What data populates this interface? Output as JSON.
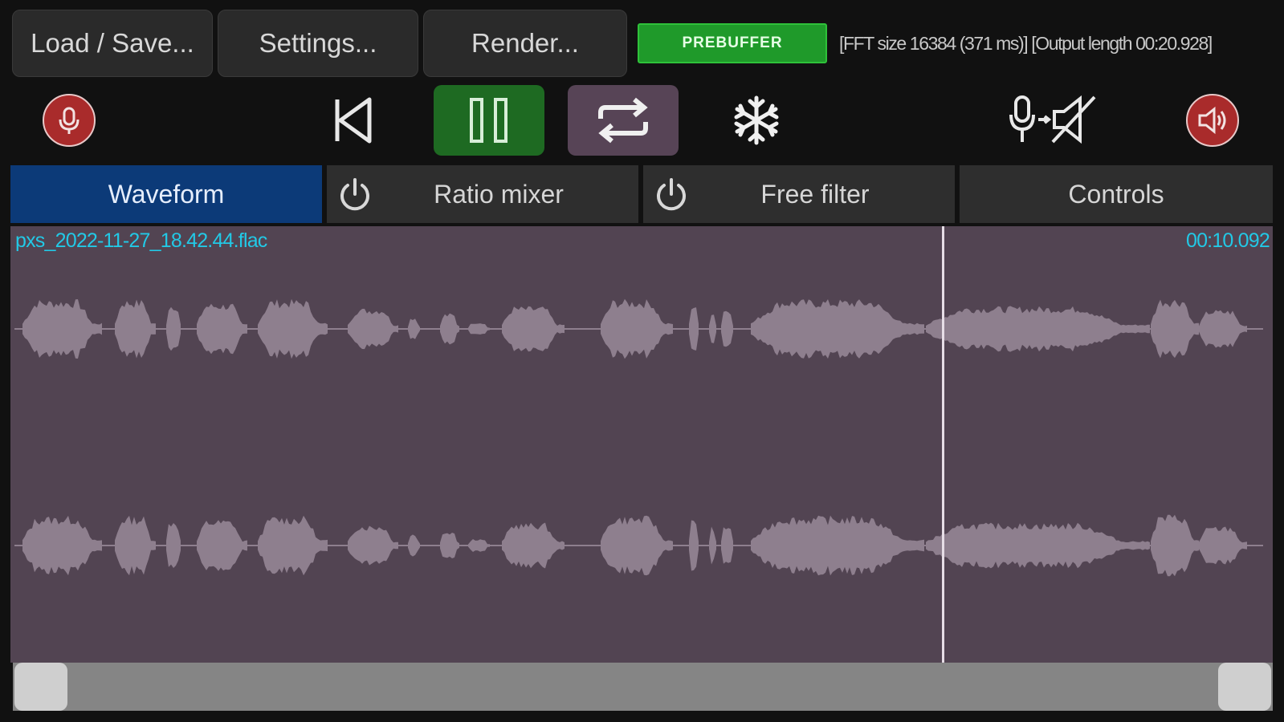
{
  "menu": {
    "load_save": "Load / Save...",
    "settings": "Settings...",
    "render": "Render..."
  },
  "status": {
    "prebuffer": "PREBUFFER",
    "info": "[FFT size 16384 (371 ms)] [Output length 00:20.928]"
  },
  "transport": {
    "icons": [
      "mic-icon",
      "rewind-icon",
      "pause-icon",
      "loop-icon",
      "snowflake-icon",
      "mic-to-mute-icon",
      "speaker-icon"
    ]
  },
  "tabs": [
    {
      "label": "Waveform",
      "active": true
    },
    {
      "label": "Ratio mixer",
      "active": false
    },
    {
      "label": "Free filter",
      "active": false
    },
    {
      "label": "Controls",
      "active": false
    }
  ],
  "waveform": {
    "filename": "pxs_2022-11-27_18.42.44.flac",
    "time": "00:10.092",
    "playhead_fraction": 0.738
  },
  "colors": {
    "accent_tab": "#0c3a78",
    "waveform_bg": "#524452",
    "waveform_fill": "#8e7f8e",
    "text_highlight": "#22c9e6",
    "play_active": "#1e6a22",
    "loop_active": "#574456",
    "prebuffer": "#1f9a2a",
    "record": "#a92b2b"
  }
}
